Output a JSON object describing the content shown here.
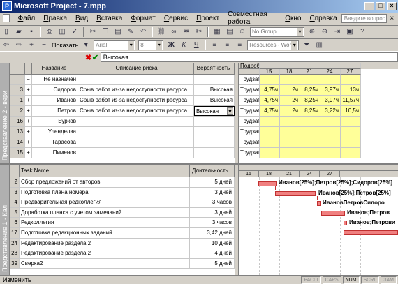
{
  "window": {
    "title": "Microsoft Project - 7.mpp"
  },
  "menu": {
    "items": [
      "Файл",
      "Правка",
      "Вид",
      "Вставка",
      "Формат",
      "Сервис",
      "Проект",
      "Совместная работа",
      "Окно",
      "Справка"
    ],
    "help_placeholder": "Введите вопрос"
  },
  "toolbar1": {
    "group_combo": "No Group"
  },
  "toolbar2": {
    "show_label": "Показать",
    "font_combo": "Arial",
    "size_combo": "8",
    "filter_combo": "Resources - Work"
  },
  "entry": {
    "value": "Высокая"
  },
  "upper_pane": {
    "label": "Представление 2 - вери",
    "columns": [
      "",
      "",
      "Название",
      "Описание риска",
      "Вероятность"
    ],
    "rows": [
      {
        "id": "",
        "pm": "−",
        "name": "Не назначен",
        "desc": "",
        "prob": ""
      },
      {
        "id": "3",
        "pm": "+",
        "name": "Сидоров",
        "desc": "Срыв работ из-за недоступности ресурса",
        "prob": "Высокая"
      },
      {
        "id": "1",
        "pm": "+",
        "name": "Иванов",
        "desc": "Срыв работ из-за недоступности ресурса",
        "prob": "Высокая"
      },
      {
        "id": "2",
        "pm": "+",
        "name": "Петров",
        "desc": "Срыв работ из-за недоступности ресурса",
        "prob": "Высокая"
      },
      {
        "id": "16",
        "pm": "+",
        "name": "Бурков",
        "desc": "",
        "prob": ""
      },
      {
        "id": "13",
        "pm": "+",
        "name": "Уленделва",
        "desc": "",
        "prob": ""
      },
      {
        "id": "14",
        "pm": "+",
        "name": "Тарасова",
        "desc": "",
        "prob": ""
      },
      {
        "id": "15",
        "pm": "+",
        "name": "Пименов",
        "desc": "",
        "prob": ""
      }
    ]
  },
  "usage_grid": {
    "detail_label": "Подроб",
    "dates": [
      "15",
      "18",
      "21",
      "24",
      "27"
    ],
    "rows": [
      {
        "label": "Трудзат",
        "values": [
          "",
          "",
          "",
          "",
          ""
        ]
      },
      {
        "label": "Трудзат",
        "values": [
          "4,75ч",
          "2ч",
          "8,25ч",
          "3,97ч",
          "13ч"
        ]
      },
      {
        "label": "Трудзат",
        "values": [
          "4,75ч",
          "2ч",
          "8,25ч",
          "3,97ч",
          "11,57ч"
        ]
      },
      {
        "label": "Трудзат",
        "values": [
          "4,75ч",
          "2ч",
          "8,25ч",
          "3,22ч",
          "10,5ч"
        ]
      },
      {
        "label": "Трудзат",
        "values": [
          "",
          "",
          "",
          "",
          ""
        ]
      },
      {
        "label": "Трудзат",
        "values": [
          "",
          "",
          "",
          "",
          ""
        ]
      },
      {
        "label": "Трудзат",
        "values": [
          "",
          "",
          "",
          "",
          ""
        ]
      },
      {
        "label": "Трудзат",
        "values": [
          "",
          "",
          "",
          "",
          ""
        ]
      }
    ]
  },
  "lower_pane": {
    "label": "Представление 1 - Кал",
    "columns": [
      "Task Name",
      "Длительность"
    ],
    "rows": [
      {
        "id": "2",
        "name": "Сбор предложений от авторов",
        "dur": "5 дней"
      },
      {
        "id": "3",
        "name": "Подготовка плана номера",
        "dur": "3 дней"
      },
      {
        "id": "4",
        "name": "Предварительная редколлегия",
        "dur": "3 часов"
      },
      {
        "id": "5",
        "name": "Доработка планса с учетом замечаний",
        "dur": "3 дней"
      },
      {
        "id": "6",
        "name": "Редколлегия",
        "dur": "3 часов"
      },
      {
        "id": "17",
        "name": "Подготовка редакционных заданий",
        "dur": "3,42 дней"
      },
      {
        "id": "24",
        "name": "Редактирование раздела 2",
        "dur": "10 дней"
      },
      {
        "id": "28",
        "name": "Редактирование раздела 2",
        "dur": "4 дней"
      },
      {
        "id": "39",
        "name": "Сверка2",
        "dur": "5 дней"
      }
    ]
  },
  "gantt": {
    "dates": [
      "15",
      "18",
      "21",
      "24",
      "27"
    ],
    "labels": [
      "Иванов[25%];Петров[25%];Сидоров[25%]",
      "Иванов[25%];Петров[25%]",
      "ИвановПетровСидоро",
      "Иванов;Петров",
      "Иванов;Петрови"
    ]
  },
  "status": {
    "text": "Изменить",
    "indicators": [
      "РАСШ",
      "CAPS",
      "NUM",
      "SCRL",
      "ЗАМ"
    ],
    "active": "NUM"
  }
}
